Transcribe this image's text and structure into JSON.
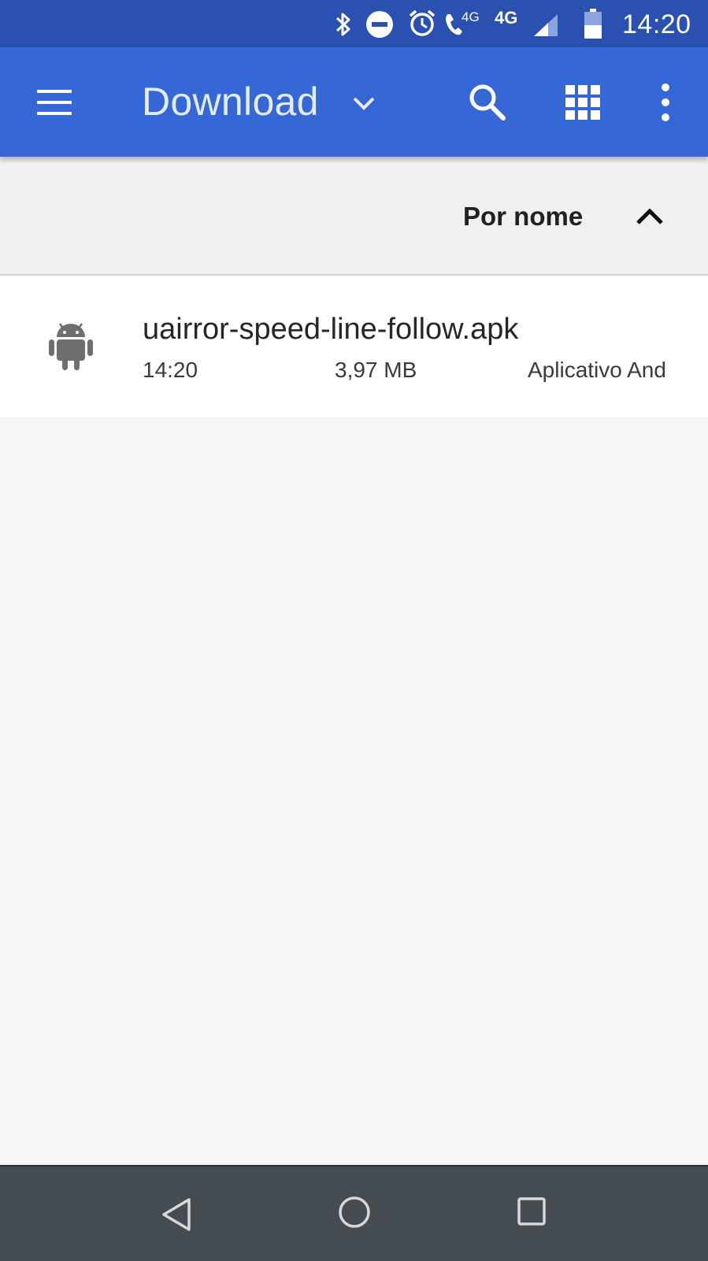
{
  "status_bar": {
    "time": "14:20",
    "network_small": "4G",
    "network_large": "4G",
    "icons": [
      "bluetooth-icon",
      "do-not-disturb-icon",
      "alarm-icon",
      "volte-call-icon",
      "signal-icon",
      "battery-icon"
    ]
  },
  "app_bar": {
    "title": "Download",
    "icons": [
      "menu-icon",
      "chevron-down-icon",
      "search-icon",
      "grid-view-icon",
      "more-vert-icon"
    ]
  },
  "sort": {
    "label": "Por nome",
    "direction_icon": "chevron-up-icon"
  },
  "files": [
    {
      "icon": "android-icon",
      "name": "uairror-speed-line-follow.apk",
      "time": "14:20",
      "size": "3,97 MB",
      "type": "Aplicativo And"
    }
  ],
  "nav_bar": {
    "icons": [
      "back-icon",
      "home-icon",
      "recents-icon"
    ]
  },
  "colors": {
    "status_bar": "#2a51b0",
    "app_bar": "#3567d6",
    "nav_bar": "#454c52",
    "background": "#f6f6f6"
  }
}
